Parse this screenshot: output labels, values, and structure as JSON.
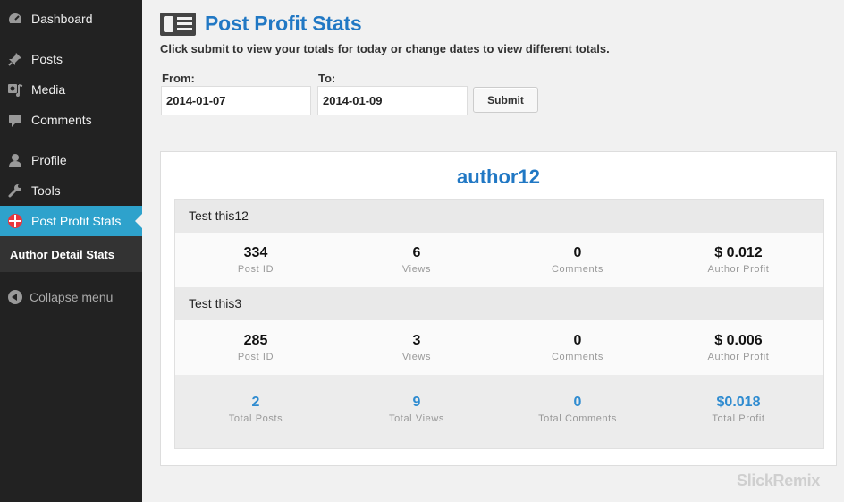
{
  "sidebar": {
    "items": [
      {
        "label": "Dashboard",
        "icon": "dashboard-icon"
      },
      {
        "label": "Posts",
        "icon": "pin-icon"
      },
      {
        "label": "Media",
        "icon": "media-icon"
      },
      {
        "label": "Comments",
        "icon": "comment-icon"
      },
      {
        "label": "Profile",
        "icon": "user-icon"
      },
      {
        "label": "Tools",
        "icon": "wrench-icon"
      },
      {
        "label": "Post Profit Stats",
        "icon": "plugin-icon"
      }
    ],
    "active_index": 6,
    "submenu_label": "Author Detail Stats",
    "collapse_label": "Collapse menu",
    "active_color": "#2ea2cc"
  },
  "page": {
    "title": "Post Profit Stats",
    "subtitle": "Click submit to view your totals for today or change dates to view different totals.",
    "from_label": "From:",
    "to_label": "To:",
    "from_value": "2014-01-07",
    "to_value": "2014-01-09",
    "submit_label": "Submit"
  },
  "author": {
    "name": "author12",
    "posts": [
      {
        "title": "Test this12",
        "post_id": "334",
        "views": "6",
        "comments": "0",
        "profit": "$ 0.012"
      },
      {
        "title": "Test this3",
        "post_id": "285",
        "views": "3",
        "comments": "0",
        "profit": "$ 0.006"
      }
    ],
    "labels": {
      "post_id": "Post ID",
      "views": "Views",
      "comments": "Comments",
      "profit": "Author Profit"
    },
    "totals": {
      "posts": "2",
      "views": "9",
      "comments": "0",
      "profit": "$0.018",
      "posts_label": "Total Posts",
      "views_label": "Total Views",
      "comments_label": "Total Comments",
      "profit_label": "Total Profit"
    }
  },
  "watermark": "SlickRemix",
  "accent": "#2178c4"
}
